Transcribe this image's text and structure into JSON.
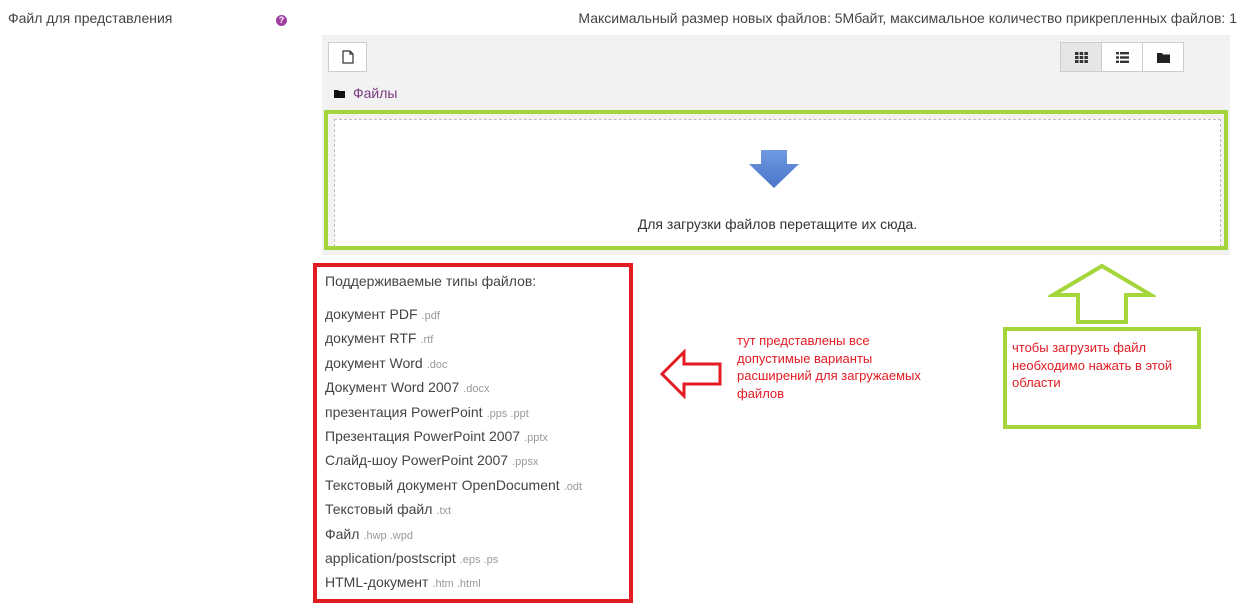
{
  "field": {
    "label": "Файл для представления",
    "help_icon": "question-circle-icon",
    "limits": "Максимальный размер новых файлов: 5Мбайт, максимальное количество прикрепленных файлов: 1"
  },
  "filepicker": {
    "add_icon": "file-add-icon",
    "view_icons": [
      "grid-view-icon",
      "list-view-icon",
      "tree-view-icon"
    ],
    "path_icon": "folder-icon",
    "path_label": "Файлы",
    "drop_icon": "down-arrow-icon",
    "drop_text": "Для загрузки файлов перетащите их сюда."
  },
  "accepted_types": {
    "title": "Поддерживаемые типы файлов:",
    "items": [
      {
        "name": "документ PDF",
        "ext": ".pdf"
      },
      {
        "name": "документ RTF",
        "ext": ".rtf"
      },
      {
        "name": "документ Word",
        "ext": ".doc"
      },
      {
        "name": "Документ Word 2007",
        "ext": ".docx"
      },
      {
        "name": "презентация PowerPoint",
        "ext": ".pps .ppt"
      },
      {
        "name": "Презентация PowerPoint 2007",
        "ext": ".pptx"
      },
      {
        "name": "Слайд-шоу PowerPoint 2007",
        "ext": ".ppsx"
      },
      {
        "name": "Текстовый документ OpenDocument",
        "ext": ".odt"
      },
      {
        "name": "Текстовый файл",
        "ext": ".txt"
      },
      {
        "name": "Файл",
        "ext": ".hwp .wpd"
      },
      {
        "name": "application/postscript",
        "ext": ".eps .ps"
      },
      {
        "name": "HTML-документ",
        "ext": ".htm .html"
      }
    ]
  },
  "annotations": {
    "types_note": "тут представлены все допустимые варианты расширений для загружаемых файлов",
    "upload_note": "чтобы загрузить файл необходимо нажать в этой области",
    "highlight_green": "#a4d53a",
    "highlight_red": "#e31b23"
  }
}
